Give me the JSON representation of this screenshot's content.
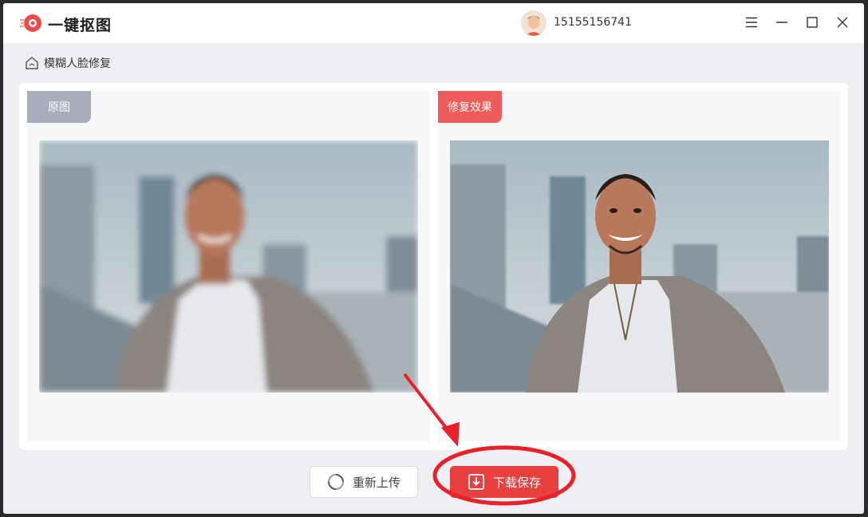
{
  "app": {
    "title": "一键抠图"
  },
  "user": {
    "phone": "15155156741"
  },
  "breadcrumb": {
    "label": "模糊人脸修复"
  },
  "panels": {
    "original_label": "原图",
    "result_label": "修复效果"
  },
  "actions": {
    "reupload_label": "重新上传",
    "save_label": "下载保存"
  },
  "colors": {
    "accent": "#e8403f",
    "tag_original": "#a9acbb",
    "tag_result": "#ef5a5a",
    "annotation": "#e8212b"
  },
  "icons": [
    "app-logo-icon",
    "menu-icon",
    "minimize-icon",
    "maximize-icon",
    "close-icon",
    "home-icon",
    "refresh-icon",
    "download-icon"
  ]
}
